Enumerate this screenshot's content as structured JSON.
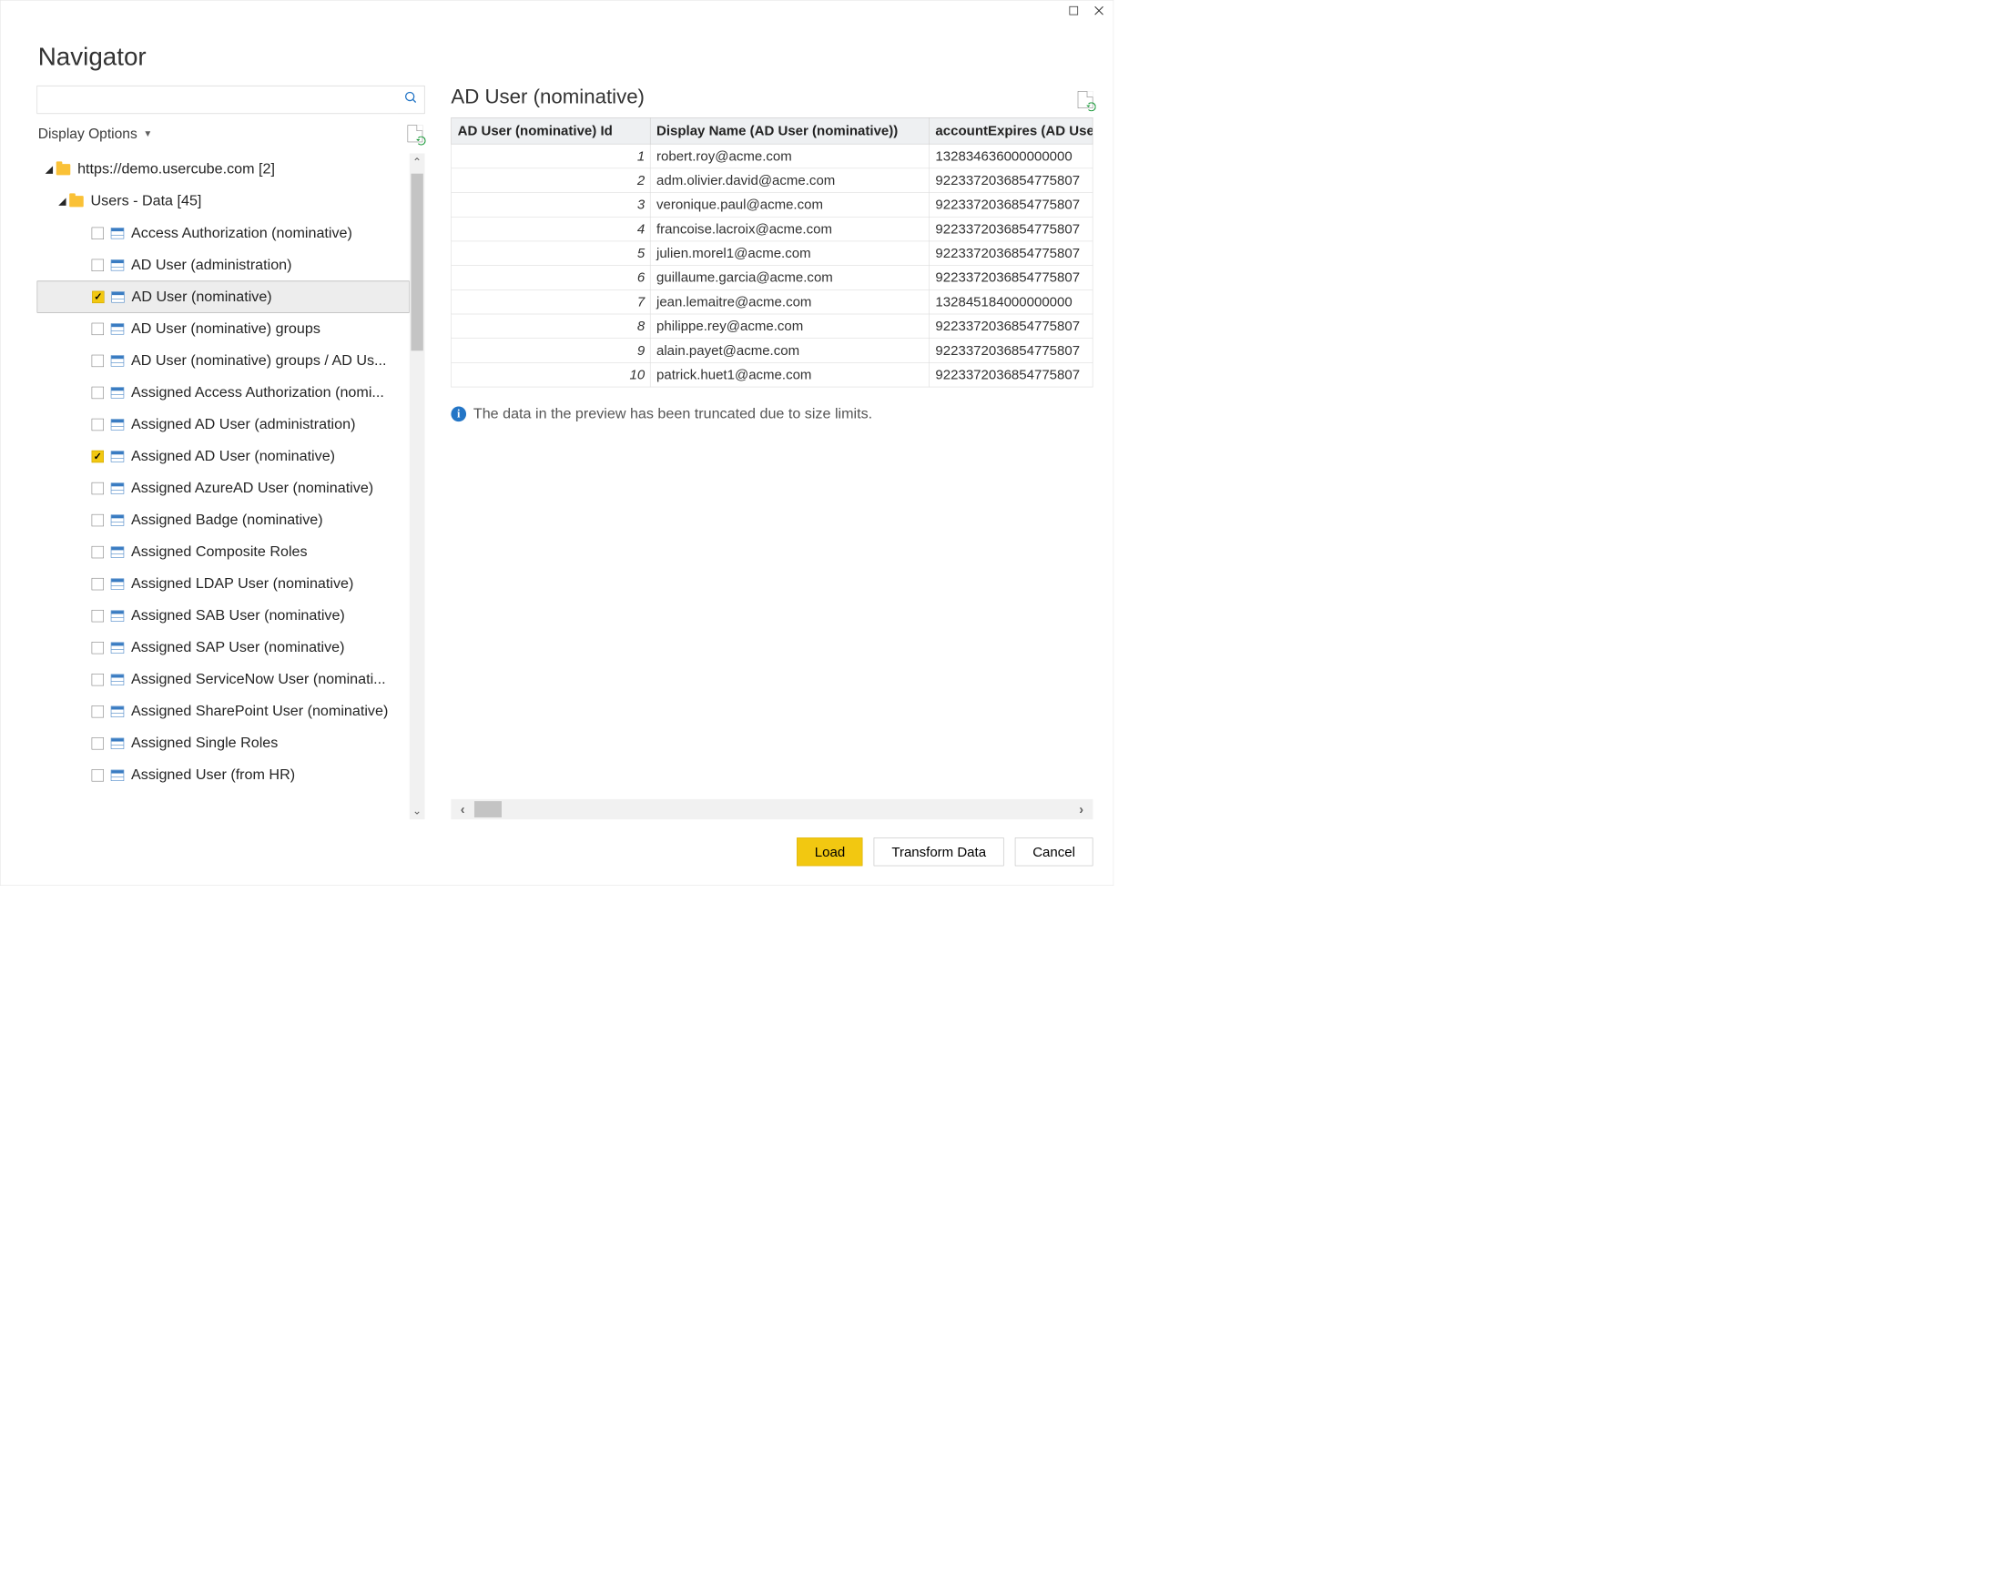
{
  "window": {
    "title": "Navigator"
  },
  "left": {
    "displayOptionsLabel": "Display Options",
    "searchPlaceholder": "",
    "root": {
      "label": "https://demo.usercube.com [2]"
    },
    "folder": {
      "label": "Users - Data [45]"
    },
    "items": [
      {
        "label": "Access Authorization (nominative)",
        "checked": false
      },
      {
        "label": "AD User (administration)",
        "checked": false
      },
      {
        "label": "AD User (nominative)",
        "checked": true,
        "selected": true
      },
      {
        "label": "AD User (nominative) groups",
        "checked": false
      },
      {
        "label": "AD User (nominative) groups / AD Us...",
        "checked": false
      },
      {
        "label": "Assigned Access Authorization (nomi...",
        "checked": false
      },
      {
        "label": "Assigned AD User (administration)",
        "checked": false
      },
      {
        "label": "Assigned AD User (nominative)",
        "checked": true
      },
      {
        "label": "Assigned AzureAD User (nominative)",
        "checked": false
      },
      {
        "label": "Assigned Badge (nominative)",
        "checked": false
      },
      {
        "label": "Assigned Composite Roles",
        "checked": false
      },
      {
        "label": "Assigned LDAP User (nominative)",
        "checked": false
      },
      {
        "label": "Assigned SAB User (nominative)",
        "checked": false
      },
      {
        "label": "Assigned SAP User (nominative)",
        "checked": false
      },
      {
        "label": "Assigned ServiceNow User (nominati...",
        "checked": false
      },
      {
        "label": "Assigned SharePoint User (nominative)",
        "checked": false
      },
      {
        "label": "Assigned Single Roles",
        "checked": false
      },
      {
        "label": "Assigned User (from HR)",
        "checked": false
      }
    ]
  },
  "right": {
    "title": "AD User (nominative)",
    "columns": [
      "AD User (nominative) Id",
      "Display Name (AD User (nominative))",
      "accountExpires (AD Use"
    ],
    "rows": [
      {
        "id": "1",
        "dn": "robert.roy@acme.com",
        "ae": "132834636000000000"
      },
      {
        "id": "2",
        "dn": "adm.olivier.david@acme.com",
        "ae": "9223372036854775807"
      },
      {
        "id": "3",
        "dn": "veronique.paul@acme.com",
        "ae": "9223372036854775807"
      },
      {
        "id": "4",
        "dn": "francoise.lacroix@acme.com",
        "ae": "9223372036854775807"
      },
      {
        "id": "5",
        "dn": "julien.morel1@acme.com",
        "ae": "9223372036854775807"
      },
      {
        "id": "6",
        "dn": "guillaume.garcia@acme.com",
        "ae": "9223372036854775807"
      },
      {
        "id": "7",
        "dn": "jean.lemaitre@acme.com",
        "ae": "132845184000000000"
      },
      {
        "id": "8",
        "dn": "philippe.rey@acme.com",
        "ae": "9223372036854775807"
      },
      {
        "id": "9",
        "dn": "alain.payet@acme.com",
        "ae": "9223372036854775807"
      },
      {
        "id": "10",
        "dn": "patrick.huet1@acme.com",
        "ae": "9223372036854775807"
      }
    ],
    "truncated": "The data in the preview has been truncated due to size limits."
  },
  "footer": {
    "load": "Load",
    "transform": "Transform Data",
    "cancel": "Cancel"
  }
}
